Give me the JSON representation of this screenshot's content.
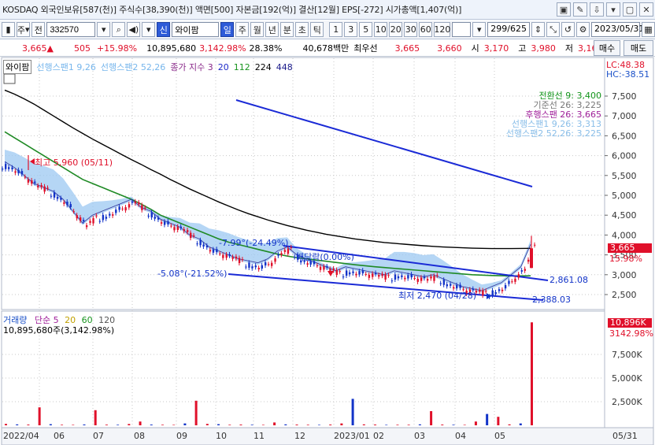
{
  "infobar": {
    "text": "KOSDAQ 외국인보유[587(천)] 주식수[38,390(천)] 액면[500] 자본금[192(억)] 결산[12월] EPS[-272] 시가총액[1,407(억)]",
    "icons": [
      "window-icon",
      "edit-icon",
      "pin-icon",
      "dropdown-icon",
      "restore-icon",
      "close-icon"
    ],
    "icon_glyphs": [
      "▣",
      "✎",
      "⇩",
      "▾",
      "▢",
      "✕"
    ]
  },
  "toolbar": {
    "market_select": "주",
    "scope": "전",
    "code": "332570",
    "stock_badge": "신",
    "stock_name": "와이팜",
    "period_active": "일",
    "periods": [
      "주",
      "월",
      "년",
      "분",
      "초",
      "틱"
    ],
    "intervals": [
      "1",
      "3",
      "5",
      "10",
      "20",
      "30",
      "60",
      "120"
    ],
    "page": "299/625",
    "date": "2023/05/31"
  },
  "priceline": {
    "price": "3,665▲",
    "change": "505",
    "change_pct": "+15.98%",
    "volume": "10,895,680",
    "volume_pct": "3,142.98%",
    "turnover": "28.38%",
    "amount": "40,678백만",
    "priority_label": "최우선",
    "ask": "3,665",
    "bid": "3,660",
    "open_label": "시",
    "open": "3,170",
    "high_label": "고",
    "high": "3,980",
    "low_label": "저",
    "low": "3,165",
    "buy_button": "매수",
    "sell_button": "매도"
  },
  "legend": {
    "tag": "와이팜",
    "span1": "선행스팬1 9,26",
    "span2": "선행스팬2 52,26",
    "ma_label": "종가 지수 3",
    "ma20": "20",
    "ma112": "112",
    "ma224": "224",
    "ma448": "448"
  },
  "right_info": {
    "lc": "LC:48.38",
    "hc": "HC:-38.51",
    "tenkan": "전환선 9: 3,400",
    "kijun": "기준선 26: 3,225",
    "chikou": "후행스팬 26: 3,665",
    "senkou1": "선행스팬1 9,26: 3,313",
    "senkou2": "선행스팬2 52,26: 3,225",
    "price_tag": "3,665",
    "price_pct": "15.98%",
    "vol_tag": "10,896K",
    "vol_pct": "3142.98%"
  },
  "annotations": {
    "high": "최고 5,960 (05/11)",
    "low": "최저 2,470 (04/28)",
    "trend1": "-7.99°(-24.49%)",
    "trend2": "-5.08°(-21.52%)",
    "ex_dividend": "배당락(0.00%)",
    "line_val1": "2,861.08",
    "line_val2": "2,388.03"
  },
  "volume_legend": {
    "title": "거래량",
    "ma_label": "단순 5",
    "ma20": "20",
    "ma60": "60",
    "ma120": "120",
    "value": "10,895,680주(3,142.98%)"
  },
  "colors": {
    "up": "#e0102a",
    "down": "#1233c8",
    "cloud": "#9cc8f2",
    "ma112": "#1f8a25",
    "ma224": "#000000",
    "trendline": "#1a2ad6"
  },
  "chart_data": {
    "type": "candlestick",
    "price_axis": [
      "7,500",
      "7,000",
      "6,500",
      "6,000",
      "5,500",
      "5,000",
      "4,500",
      "4,000",
      "3,500",
      "3,000",
      "2,500"
    ],
    "price_axis_values": [
      7500,
      7000,
      6500,
      6000,
      5500,
      5000,
      4500,
      4000,
      3500,
      3000,
      2500
    ],
    "volume_axis": [
      "7,500K",
      "5,000K",
      "2,500K"
    ],
    "volume_axis_values": [
      7500,
      5000,
      2500
    ],
    "x_labels": [
      "2022/04",
      "06",
      "07",
      "08",
      "09",
      "10",
      "11",
      "12",
      "2023/01",
      "02",
      "03",
      "04",
      "05",
      "05/31"
    ],
    "close_series": [
      5750,
      5600,
      5400,
      5200,
      5100,
      5000,
      4800,
      4500,
      4200,
      4400,
      4500,
      4600,
      4700,
      4800,
      4600,
      4500,
      4300,
      4200,
      4100,
      3900,
      3800,
      3600,
      3500,
      3400,
      3300,
      3250,
      3200,
      3300,
      3500,
      3600,
      3400,
      3300,
      3200,
      3100,
      3000,
      3100,
      3050,
      3000,
      2950,
      2900,
      3000,
      2950,
      2900,
      2850,
      2900,
      2800,
      2700,
      2600,
      2550,
      2500,
      2600,
      2700,
      2900,
      3100,
      3665
    ],
    "ma112": [
      6600,
      6450,
      6300,
      6150,
      6000,
      5850,
      5700,
      5550,
      5400,
      5300,
      5200,
      5100,
      5000,
      4900,
      4780,
      4650,
      4500,
      4400,
      4300,
      4200,
      4100,
      4000,
      3900,
      3820,
      3760,
      3700,
      3640,
      3580,
      3520,
      3470,
      3430,
      3400,
      3370,
      3340,
      3310,
      3280,
      3250,
      3225,
      3200,
      3180,
      3160,
      3140,
      3120,
      3100,
      3080,
      3060,
      3040,
      3020,
      3000,
      2990,
      2980,
      2975,
      2970,
      2970,
      2972
    ],
    "ma224": [
      7650,
      7550,
      7430,
      7300,
      7150,
      7000,
      6850,
      6700,
      6560,
      6420,
      6290,
      6160,
      6030,
      5900,
      5780,
      5650,
      5530,
      5400,
      5280,
      5160,
      5050,
      4940,
      4830,
      4730,
      4630,
      4540,
      4460,
      4380,
      4310,
      4240,
      4180,
      4120,
      4070,
      4020,
      3980,
      3940,
      3900,
      3870,
      3840,
      3810,
      3790,
      3770,
      3750,
      3730,
      3715,
      3700,
      3690,
      3680,
      3670,
      3665,
      3660,
      3660,
      3660,
      3662,
      3665
    ],
    "trendline_upper": [
      [
        47,
        7200
      ],
      [
        100,
        5000
      ]
    ],
    "volume": [
      150,
      100,
      80,
      1900,
      120,
      60,
      50,
      90,
      1600,
      70,
      60,
      140,
      400,
      80,
      60,
      50,
      200,
      2600,
      150,
      120,
      60,
      80,
      60,
      50,
      300,
      100,
      80,
      60,
      50,
      80,
      200,
      2800,
      100,
      80,
      50,
      60,
      60,
      100,
      1500,
      80,
      60,
      50,
      400,
      1200,
      900,
      100,
      200,
      10896
    ]
  }
}
